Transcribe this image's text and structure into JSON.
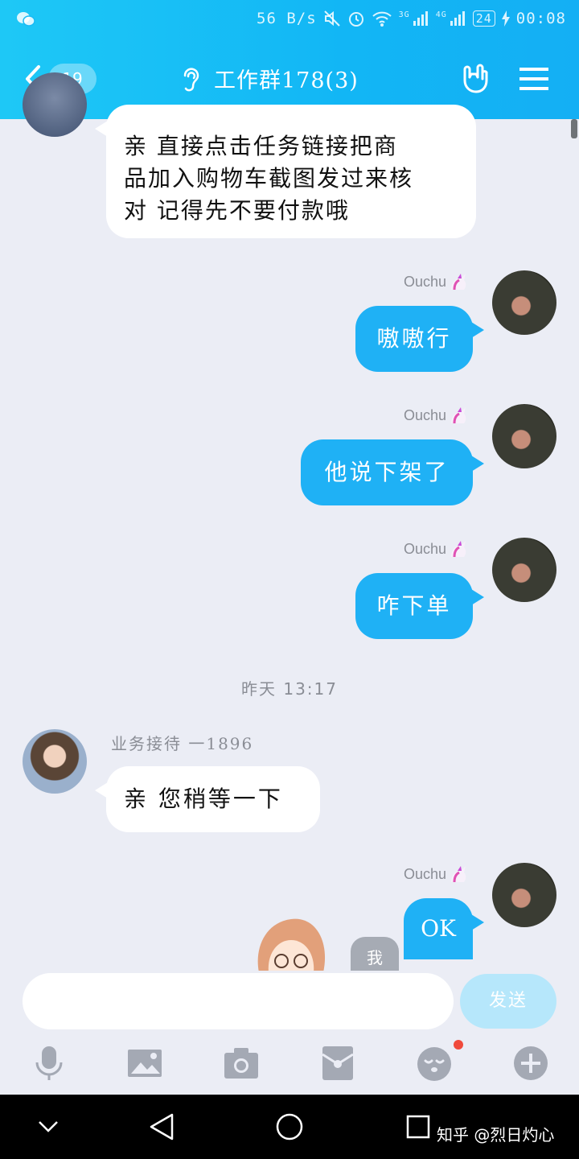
{
  "status_bar": {
    "net_speed": "56 B/s",
    "network_3g": "3G",
    "network_4g": "4G",
    "battery": "24",
    "time": "00:08"
  },
  "header": {
    "unread_count": "19",
    "title": "工作群178(3)"
  },
  "messages": {
    "m1": {
      "text_line1": "亲 直接点击任务链接把商",
      "text_line2": "品加入购物车截图发过来核",
      "text_line3": "对 记得先不要付款哦"
    },
    "m2": {
      "sender": "Ouchu",
      "text": "嗷嗷行"
    },
    "m3": {
      "sender": "Ouchu",
      "text": "他说下架了"
    },
    "m4": {
      "sender": "Ouchu",
      "text": "咋下单"
    },
    "timestamp": "昨天 13:17",
    "m5": {
      "sender": "业务接待 一1896",
      "text": "亲 您稍等一下"
    },
    "m6": {
      "sender": "Ouchu",
      "text": "OK"
    },
    "partial_label": "我"
  },
  "input": {
    "placeholder": "",
    "send_label": "发送"
  },
  "toolbar_icons": [
    "microphone-icon",
    "image-icon",
    "camera-icon",
    "red-packet-icon",
    "emoji-icon",
    "plus-icon"
  ],
  "watermark": "知乎 @烈日灼心",
  "colors": {
    "header_blue": "#12b6f5",
    "own_bubble": "#1fb1f5",
    "send_button": "#b6e7fb",
    "background": "#ebedf5",
    "notification_dot": "#f04a3c"
  }
}
